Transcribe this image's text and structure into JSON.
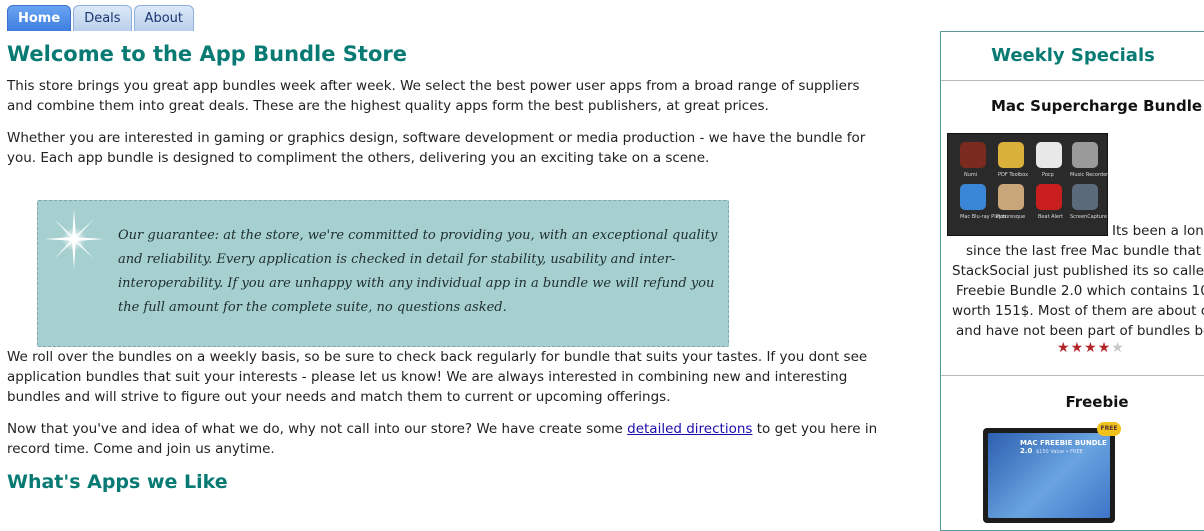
{
  "nav": {
    "tabs": [
      {
        "label": "Home",
        "active": true
      },
      {
        "label": "Deals",
        "active": false
      },
      {
        "label": "About",
        "active": false
      }
    ]
  },
  "main": {
    "title": "Welcome to the App Bundle Store",
    "para1": "This store brings you great app bundles week after week. We select the best power user apps from a broad range of suppliers and combine them into great deals. These are the highest quality apps form the best publishers, at great prices.",
    "para2": "Whether you are interested in gaming or graphics design, software development or media production - we have the bundle for you. Each app bundle is designed to compliment the others, delivering you an exciting take on a scene.",
    "guarantee": "Our guarantee: at the store, we're committed to providing you, with an exceptional quality and reliability. Every application is checked in detail for stability, usability and inter-interoperability. If you are unhappy with any individual app in a bundle we will refund you the full amount for the complete suite, no questions asked.",
    "para3": "We roll over the bundles on a weekly basis, so be sure to check back regularly for bundle that suits your tastes. If you dont see application bundles that suit your interests - please let us know! We are always interested in combining new and interesting bundles and will strive to figure out your needs and match them to current or upcoming offerings.",
    "para4_before": "Now that you've and idea of what we do, why not call into our store? We have create some ",
    "para4_link": "detailed directions",
    "para4_after": " to get you here in record time. Come and join us anytime.",
    "subheading": "What's Apps we Like"
  },
  "sidebar": {
    "title": "Weekly Specials",
    "offer1": {
      "title": "Mac Supercharge Bundle",
      "thumb_labels": [
        "Numi",
        "PDF Toolbox",
        "Pocp",
        "Music Recorder",
        "Mac Blu-ray Player",
        "Picturesque",
        "Beat Alert",
        "ScreenCapture"
      ],
      "desc_lines": [
        "Its been a lon",
        "since the last free Mac bundle that",
        "StackSocial just published its so calle",
        "Freebie Bundle 2.0 which contains 10",
        "worth 151$. Most of them are about c",
        "and have not been part of bundles be"
      ],
      "rating": 3.5,
      "rating_max": 5
    },
    "offer2": {
      "title": "Freebie",
      "image_title": "MAC FREEBIE BUNDLE 2.0",
      "image_sub": "$150 Value • FREE",
      "badge": "FREE"
    }
  },
  "colors": {
    "heading": "#087a74",
    "quote_bg": "#a6cfcf",
    "star_on": "#b2262a",
    "star_off": "#c7c7c7",
    "tab_active": "#3d7fe0"
  }
}
